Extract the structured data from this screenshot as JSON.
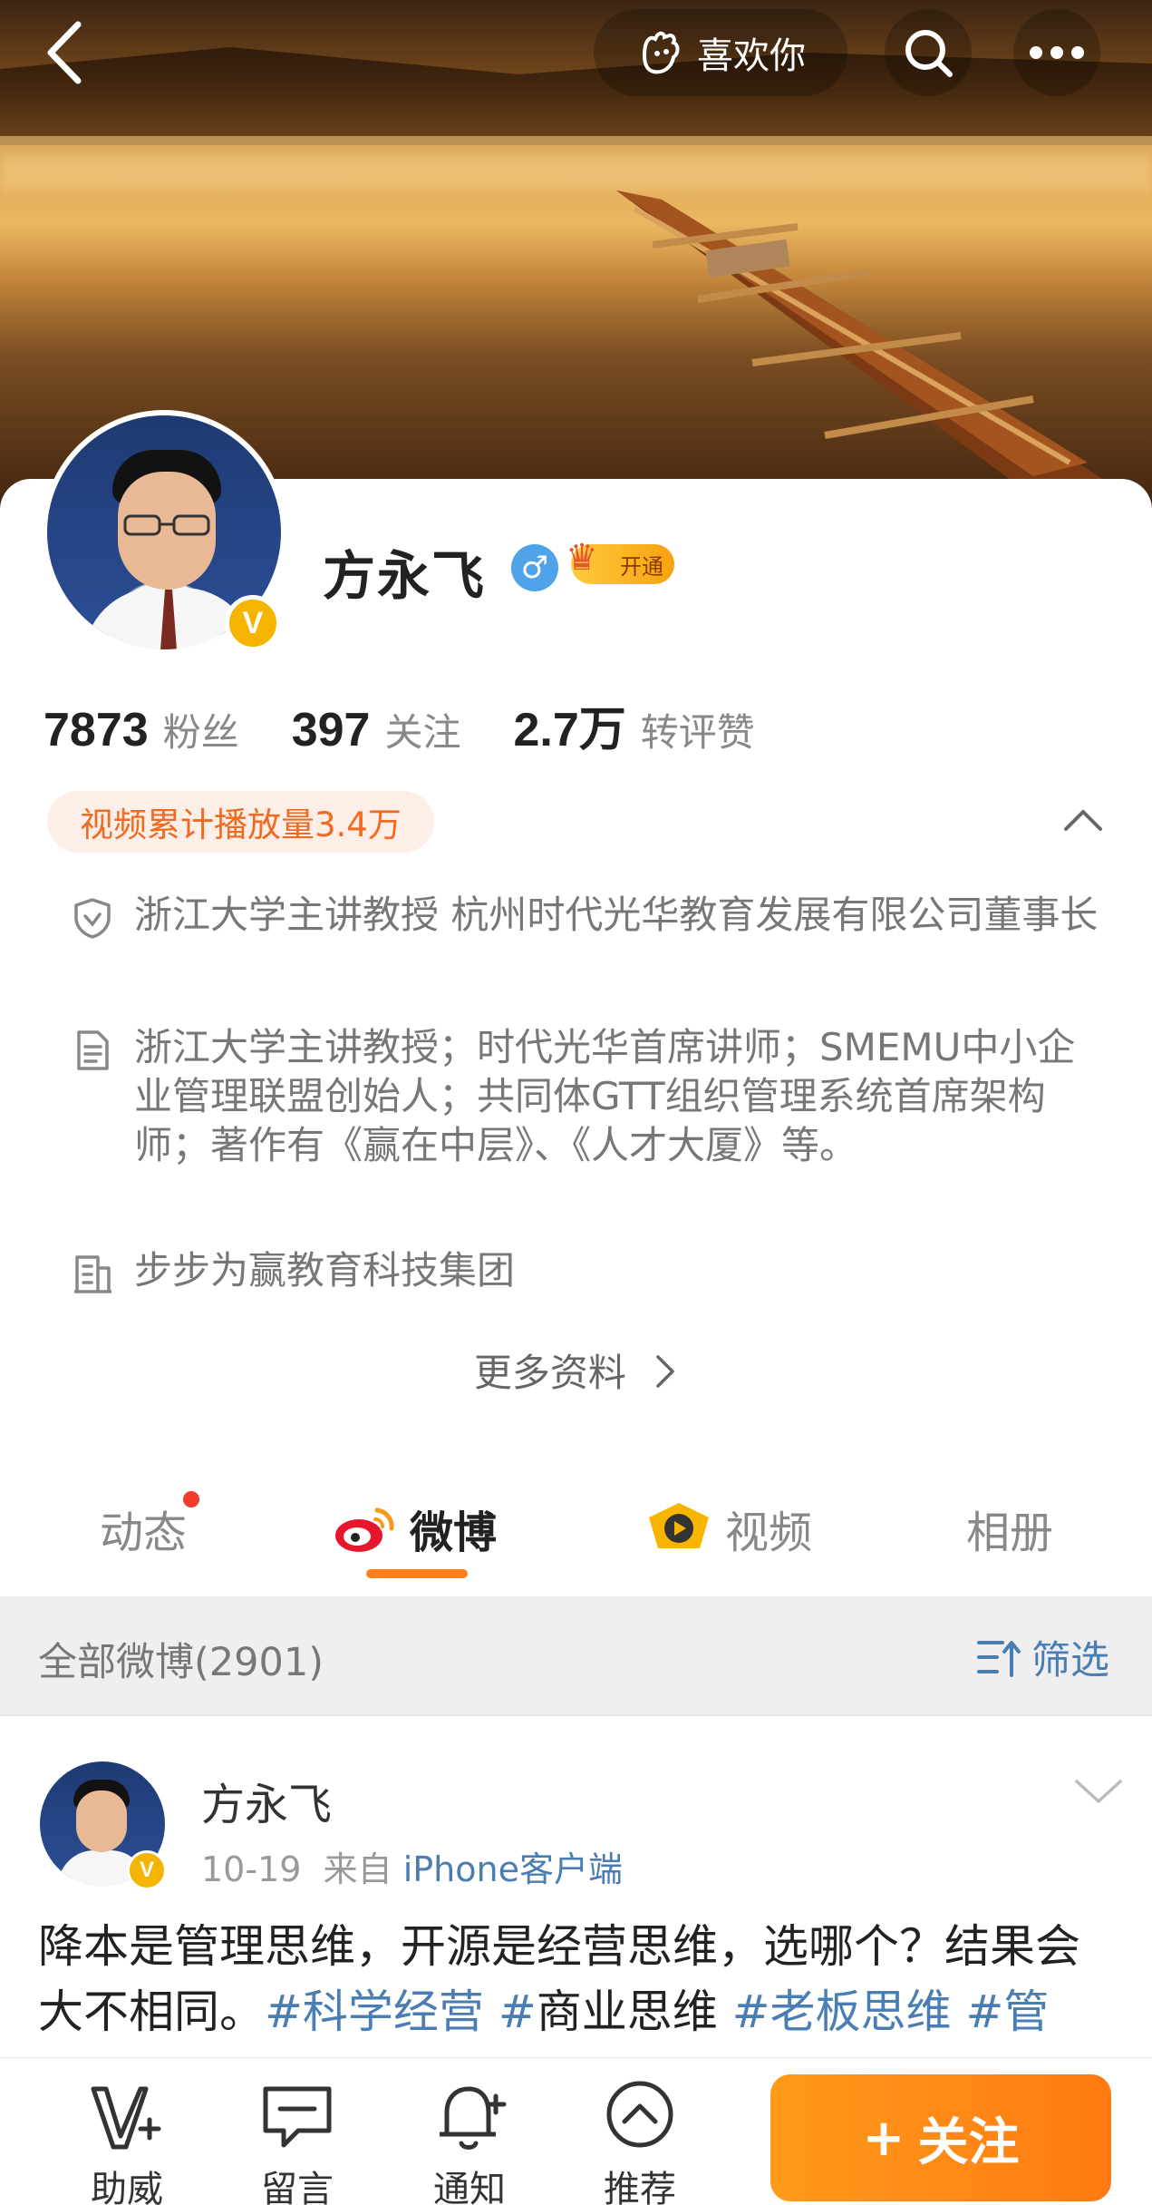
{
  "header": {
    "like_label": "喜欢你",
    "back_icon": "chevron-left-icon",
    "search_icon": "search-icon",
    "more_icon": "more-dots-icon"
  },
  "profile": {
    "name": "方永飞",
    "gender_symbol": "♂",
    "vip_label": "开通",
    "verified_mark": "V",
    "stats": [
      {
        "num": "7873",
        "label": "粉丝"
      },
      {
        "num": "397",
        "label": "关注"
      },
      {
        "num": "2.7万",
        "label": "转评赞"
      }
    ],
    "video_plays": "视频累计播放量3.4万",
    "info": [
      {
        "icon": "shield-icon",
        "text": "浙江大学主讲教授 杭州时代光华教育发展有限公司董事长"
      },
      {
        "icon": "document-icon",
        "text": "浙江大学主讲教授；时代光华首席讲师；SMEMU中小企业管理联盟创始人；共同体GTT组织管理系统首席架构师；著作有《赢在中层》、《人才大厦》等。"
      },
      {
        "icon": "building-icon",
        "text": "步步为赢教育科技集团"
      }
    ],
    "more_label": "更多资料"
  },
  "tabs": [
    {
      "label": "动态",
      "has_dot": true
    },
    {
      "label": "微博",
      "active": true
    },
    {
      "label": "视频"
    },
    {
      "label": "相册"
    }
  ],
  "feed": {
    "count_label": "全部微博(2901)",
    "filter_label": "筛选"
  },
  "post": {
    "author": "方永飞",
    "date": "10-19",
    "from_prefix": "来自",
    "source": "iPhone客户端",
    "text_plain_1": "降本是管理思维，开源是经营思维，选哪个？结果会大不相同。",
    "tag_1": "#科学经营",
    "tag_2_hash": "#",
    "tag_2_text": "商业思维",
    "tag_3": "#老板思维",
    "tag_4": "#管"
  },
  "bottom_bar": {
    "items": [
      {
        "label": "助威",
        "icon": "cheer-v-icon"
      },
      {
        "label": "留言",
        "icon": "message-icon"
      },
      {
        "label": "通知",
        "icon": "bell-plus-icon"
      },
      {
        "label": "推荐",
        "icon": "up-circle-icon"
      }
    ],
    "follow_label": "关注",
    "follow_plus": "+"
  },
  "colors": {
    "accent": "#ff7f1f",
    "link": "#4a7db3",
    "verified": "#f5b400"
  }
}
